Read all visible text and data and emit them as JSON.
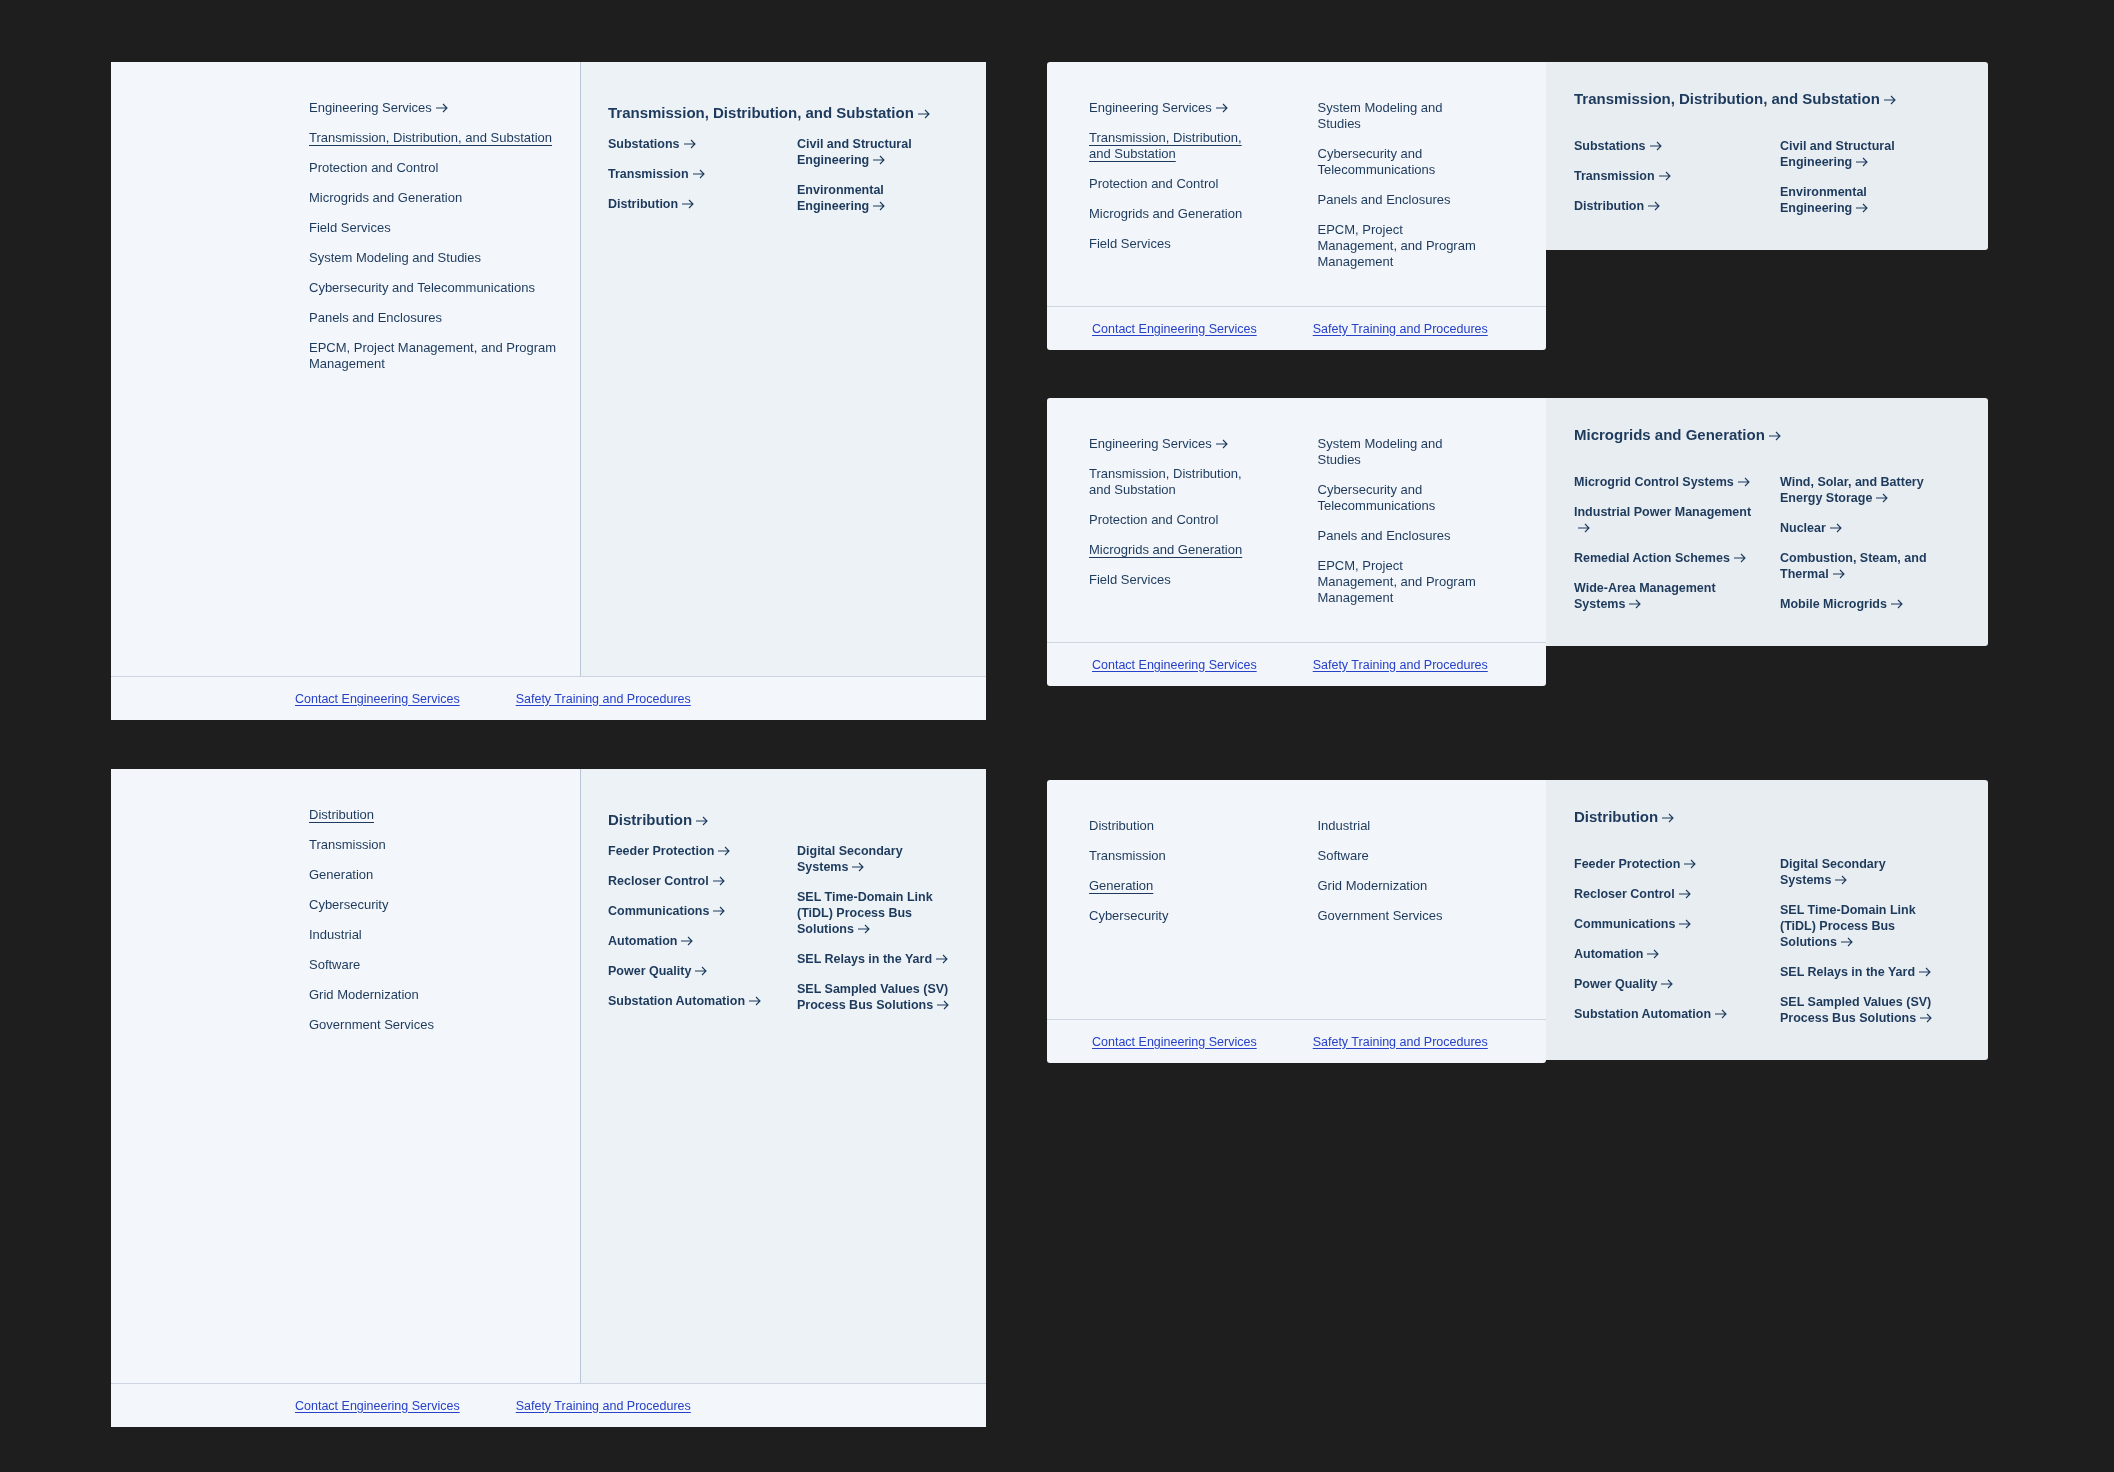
{
  "panels": [
    {
      "kind": "wide",
      "nav_columns": [
        [
          {
            "label": "Engineering Services",
            "arrow": true,
            "selected": false
          },
          {
            "label": "Transmission, Distribution, and Substation",
            "arrow": false,
            "selected": true
          },
          {
            "label": "Protection and Control",
            "arrow": false,
            "selected": false
          },
          {
            "label": "Microgrids and Generation",
            "arrow": false,
            "selected": false
          },
          {
            "label": "Field Services",
            "arrow": false,
            "selected": false
          },
          {
            "label": "System Modeling and Studies",
            "arrow": false,
            "selected": false
          },
          {
            "label": "Cybersecurity and Telecommunications",
            "arrow": false,
            "selected": false
          },
          {
            "label": "Panels and Enclosures",
            "arrow": false,
            "selected": false
          },
          {
            "label": "EPCM, Project Management, and Program Management",
            "arrow": false,
            "selected": false
          }
        ]
      ],
      "detail": {
        "title": "Transmission, Distribution, and Substation",
        "columns": [
          [
            "Substations",
            "Transmission",
            "Distribution"
          ],
          [
            "Civil and Structural Engineering",
            "Environmental Engineering"
          ]
        ]
      },
      "footer_links": [
        "Contact Engineering Services",
        "Safety Training and Procedures"
      ]
    },
    {
      "kind": "wide",
      "nav_columns": [
        [
          {
            "label": "Distribution",
            "arrow": false,
            "selected": true
          },
          {
            "label": "Transmission",
            "arrow": false,
            "selected": false
          },
          {
            "label": "Generation",
            "arrow": false,
            "selected": false
          },
          {
            "label": "Cybersecurity",
            "arrow": false,
            "selected": false
          },
          {
            "label": "Industrial",
            "arrow": false,
            "selected": false
          },
          {
            "label": "Software",
            "arrow": false,
            "selected": false
          },
          {
            "label": "Grid Modernization",
            "arrow": false,
            "selected": false
          },
          {
            "label": "Government Services",
            "arrow": false,
            "selected": false
          }
        ]
      ],
      "detail": {
        "title": "Distribution",
        "columns": [
          [
            "Feeder Protection",
            "Recloser Control",
            "Communications",
            "Automation",
            "Power Quality",
            "Substation Automation"
          ],
          [
            "Digital Secondary Systems",
            "SEL Time-Domain Link (TiDL) Process Bus Solutions",
            "SEL Relays in the Yard",
            "SEL Sampled Values (SV) Process Bus Solutions"
          ]
        ]
      },
      "footer_links": [
        "Contact Engineering Services",
        "Safety Training and Procedures"
      ]
    },
    {
      "kind": "compact",
      "nav_columns": [
        [
          {
            "label": "Engineering Services",
            "arrow": true,
            "selected": false
          },
          {
            "label": "Transmission, Distribution, and Substation",
            "arrow": false,
            "selected": true
          },
          {
            "label": "Protection and Control",
            "arrow": false,
            "selected": false
          },
          {
            "label": "Microgrids and Generation",
            "arrow": false,
            "selected": false
          },
          {
            "label": "Field Services",
            "arrow": false,
            "selected": false
          }
        ],
        [
          {
            "label": "System Modeling and Studies",
            "arrow": false,
            "selected": false
          },
          {
            "label": "Cybersecurity and Telecommunications",
            "arrow": false,
            "selected": false
          },
          {
            "label": "Panels and Enclosures",
            "arrow": false,
            "selected": false
          },
          {
            "label": "EPCM, Project Management, and Program Management",
            "arrow": false,
            "selected": false
          }
        ]
      ],
      "detail": {
        "title": "Transmission, Distribution, and Substation",
        "columns": [
          [
            "Substations",
            "Transmission",
            "Distribution"
          ],
          [
            "Civil and Structural Engineering",
            "Environmental Engineering"
          ]
        ]
      },
      "footer_links": [
        "Contact Engineering Services",
        "Safety Training and Procedures"
      ]
    },
    {
      "kind": "compact",
      "nav_columns": [
        [
          {
            "label": "Engineering Services",
            "arrow": true,
            "selected": false
          },
          {
            "label": "Transmission, Distribution, and Substation",
            "arrow": false,
            "selected": false
          },
          {
            "label": "Protection and Control",
            "arrow": false,
            "selected": false
          },
          {
            "label": "Microgrids and Generation",
            "arrow": false,
            "selected": true
          },
          {
            "label": "Field Services",
            "arrow": false,
            "selected": false
          }
        ],
        [
          {
            "label": "System Modeling and Studies",
            "arrow": false,
            "selected": false
          },
          {
            "label": "Cybersecurity and Telecommunications",
            "arrow": false,
            "selected": false
          },
          {
            "label": "Panels and Enclosures",
            "arrow": false,
            "selected": false
          },
          {
            "label": "EPCM, Project Management, and Program Management",
            "arrow": false,
            "selected": false
          }
        ]
      ],
      "detail": {
        "title": "Microgrids and Generation",
        "columns": [
          [
            "Microgrid Control Systems",
            "Industrial Power Management",
            "Remedial Action Schemes",
            "Wide-Area Management Systems"
          ],
          [
            "Wind, Solar, and Battery Energy Storage",
            "Nuclear",
            "Combustion, Steam, and Thermal",
            "Mobile Microgrids"
          ]
        ]
      },
      "footer_links": [
        "Contact Engineering Services",
        "Safety Training and Procedures"
      ]
    },
    {
      "kind": "compact",
      "nav_columns": [
        [
          {
            "label": "Distribution",
            "arrow": false,
            "selected": false
          },
          {
            "label": "Transmission",
            "arrow": false,
            "selected": false
          },
          {
            "label": "Generation",
            "arrow": false,
            "selected": true
          },
          {
            "label": "Cybersecurity",
            "arrow": false,
            "selected": false
          }
        ],
        [
          {
            "label": "Industrial",
            "arrow": false,
            "selected": false
          },
          {
            "label": "Software",
            "arrow": false,
            "selected": false
          },
          {
            "label": "Grid Modernization",
            "arrow": false,
            "selected": false
          },
          {
            "label": "Government Services",
            "arrow": false,
            "selected": false
          }
        ]
      ],
      "detail": {
        "title": "Distribution",
        "columns": [
          [
            "Feeder Protection",
            "Recloser Control",
            "Communications",
            "Automation",
            "Power Quality",
            "Substation Automation"
          ],
          [
            "Digital Secondary Systems",
            "SEL Time-Domain Link (TiDL) Process Bus Solutions",
            "SEL Relays in the Yard",
            "SEL Sampled Values (SV) Process Bus Solutions"
          ]
        ]
      },
      "footer_links": [
        "Contact Engineering Services",
        "Safety Training and Procedures"
      ]
    }
  ]
}
